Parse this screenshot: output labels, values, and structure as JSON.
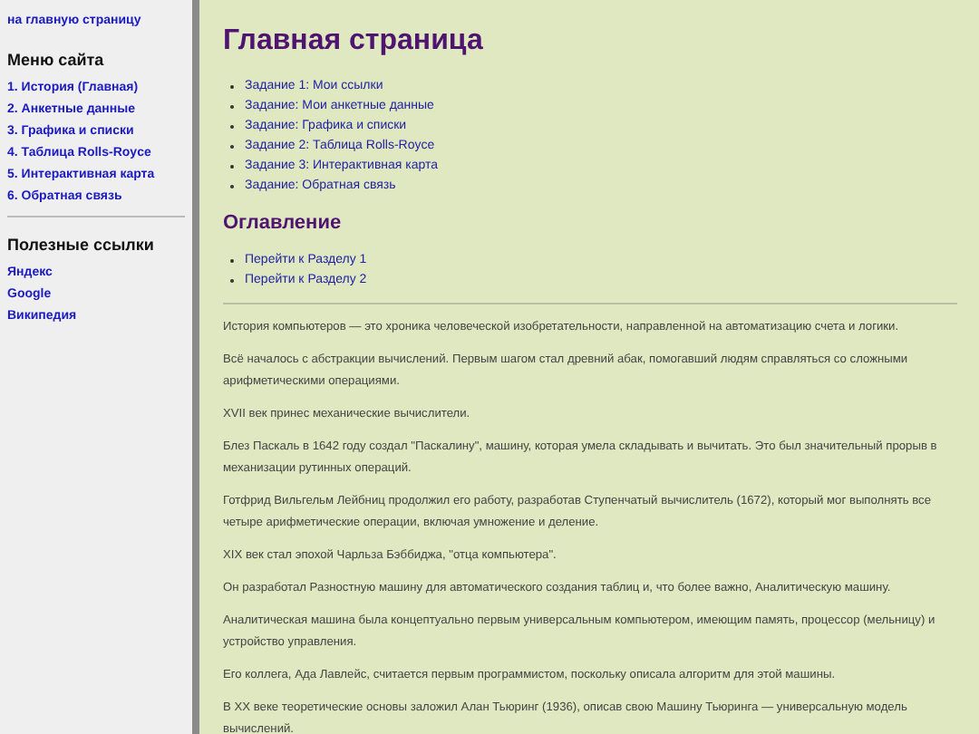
{
  "sidebar": {
    "home_link": "на главную страницу",
    "menu_title": "Меню сайта",
    "menu_items": [
      "1. История (Главная)",
      "2. Анкетные данные",
      "3. Графика и списки",
      "4. Таблица Rolls-Royce",
      "5. Интерактивная карта",
      "6. Обратная связь"
    ],
    "links_title": "Полезные ссылки",
    "links": [
      "Яндекс",
      "Google",
      "Википедия"
    ]
  },
  "main": {
    "title": "Главная страница",
    "tasks": [
      "Задание 1: Мои ссылки",
      "Задание: Мои анкетные данные",
      "Задание: Графика и списки",
      "Задание 2: Таблица Rolls-Royce",
      "Задание 3: Интерактивная карта",
      "Задание: Обратная связь"
    ],
    "toc_title": "Оглавление",
    "toc": [
      "Перейти к Разделу 1",
      "Перейти к Разделу 2"
    ],
    "paragraphs": [
      "История компьютеров — это хроника человеческой изобретательности, направленной на автоматизацию счета и логики.",
      "Всё началось с абстракции вычислений. Первым шагом стал древний абак, помогавший людям справляться со сложными арифметическими операциями.",
      "XVII век принес механические вычислители.",
      "Блез Паскаль в 1642 году создал \"Паскалину\", машину, которая умела складывать и вычитать. Это был значительный прорыв в механизации рутинных операций.",
      "Готфрид Вильгельм Лейбниц продолжил его работу, разработав Ступенчатый вычислитель (1672), который мог выполнять все четыре арифметические операции, включая умножение и деление.",
      "XIX век стал эпохой Чарльза Бэббиджа, \"отца компьютера\".",
      "Он разработал Разностную машину для автоматического создания таблиц и, что более важно, Аналитическую машину.",
      "Аналитическая машина была концептуально первым универсальным компьютером, имеющим память, процессор (мельницу) и устройство управления.",
      "Его коллега, Ада Лавлейс, считается первым программистом, поскольку описала алгоритм для этой машины.",
      "В XX веке теоретические основы заложил Алан Тьюринг (1936), описав свою Машину Тьюринга — универсальную модель вычислений."
    ]
  }
}
